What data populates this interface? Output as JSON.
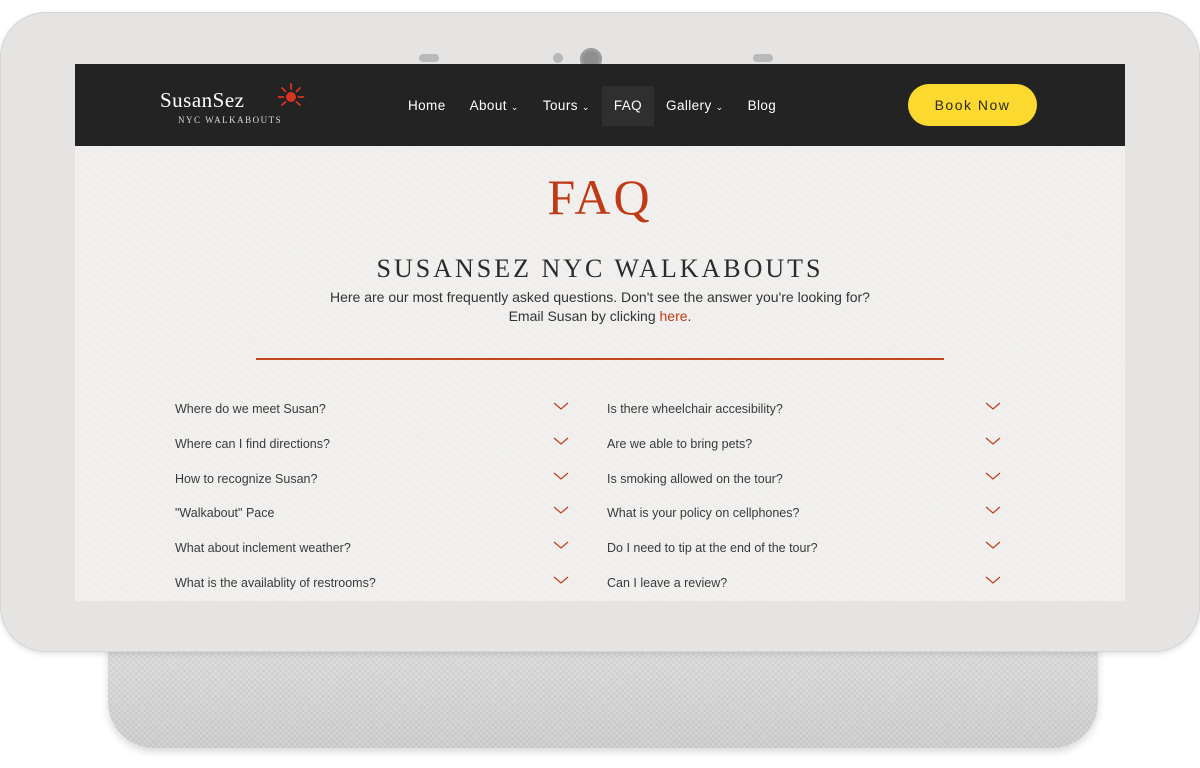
{
  "nav": {
    "logo_name": "SusanSez",
    "logo_tagline": "NYC WALKABOUTS",
    "items": [
      {
        "label": "Home",
        "has_dropdown": false,
        "active": false
      },
      {
        "label": "About",
        "has_dropdown": true,
        "active": false
      },
      {
        "label": "Tours",
        "has_dropdown": true,
        "active": false
      },
      {
        "label": "FAQ",
        "has_dropdown": false,
        "active": true
      },
      {
        "label": "Gallery",
        "has_dropdown": true,
        "active": false
      },
      {
        "label": "Blog",
        "has_dropdown": false,
        "active": false
      }
    ],
    "book_label": "Book Now"
  },
  "page": {
    "title": "FAQ",
    "subtitle": "SUSANSEZ NYC WALKABOUTS",
    "intro": "Here are our most frequently asked questions. Don't see the answer you're looking for? Email Susan by clicking",
    "intro_link": "here",
    "intro_end": "."
  },
  "faq": {
    "left": [
      "Where do we meet Susan?",
      "Where can I find directions?",
      "How to recognize Susan?",
      "\"Walkabout\" Pace",
      "What about inclement weather?",
      "What is the availablity of restrooms?"
    ],
    "right": [
      "Is there wheelchair accesibility?",
      "Are we able to bring pets?",
      "Is smoking allowed on the tour?",
      "What is your policy on cellphones?",
      "Do I need to tip at the end of the tour?",
      "Can I leave a review?"
    ]
  },
  "colors": {
    "accent": "#bf3b16",
    "nav_bg": "#232323",
    "button": "#fcd92e",
    "page_bg": "#f1f0ee"
  }
}
